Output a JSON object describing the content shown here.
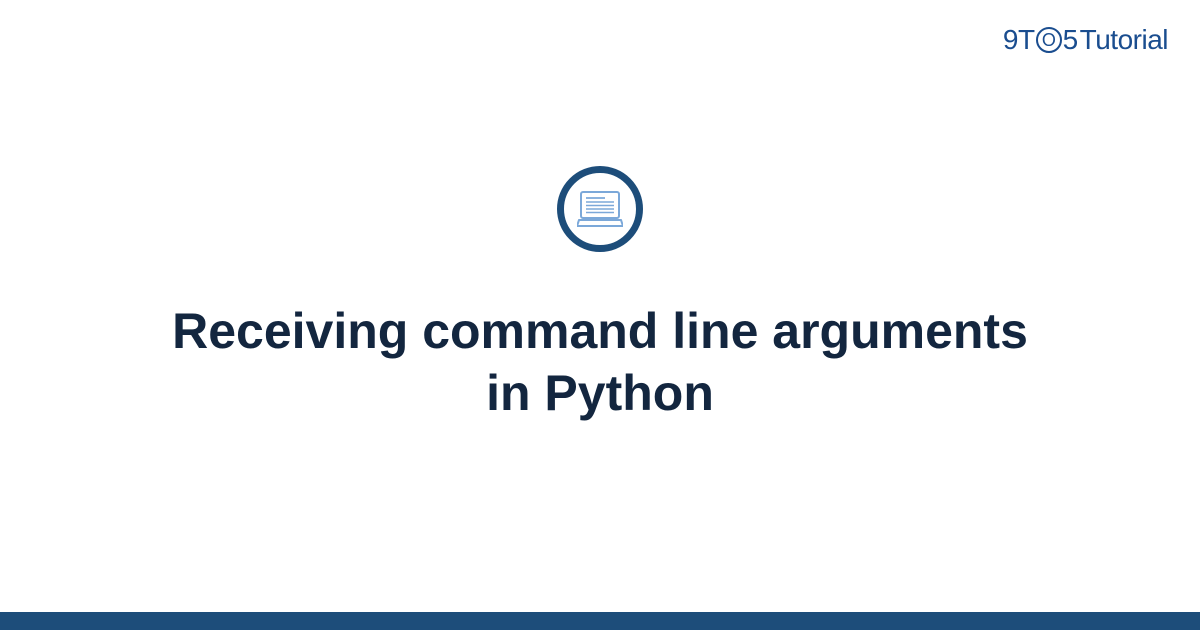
{
  "logo": {
    "part1": "9",
    "part2": "T",
    "circle": "O",
    "part3": "5",
    "part4": "Tutorial"
  },
  "title": "Receiving command line arguments in Python",
  "icon_name": "laptop-icon",
  "colors": {
    "brand": "#1a4d8f",
    "footer": "#1d4d7a",
    "title": "#13263f"
  }
}
